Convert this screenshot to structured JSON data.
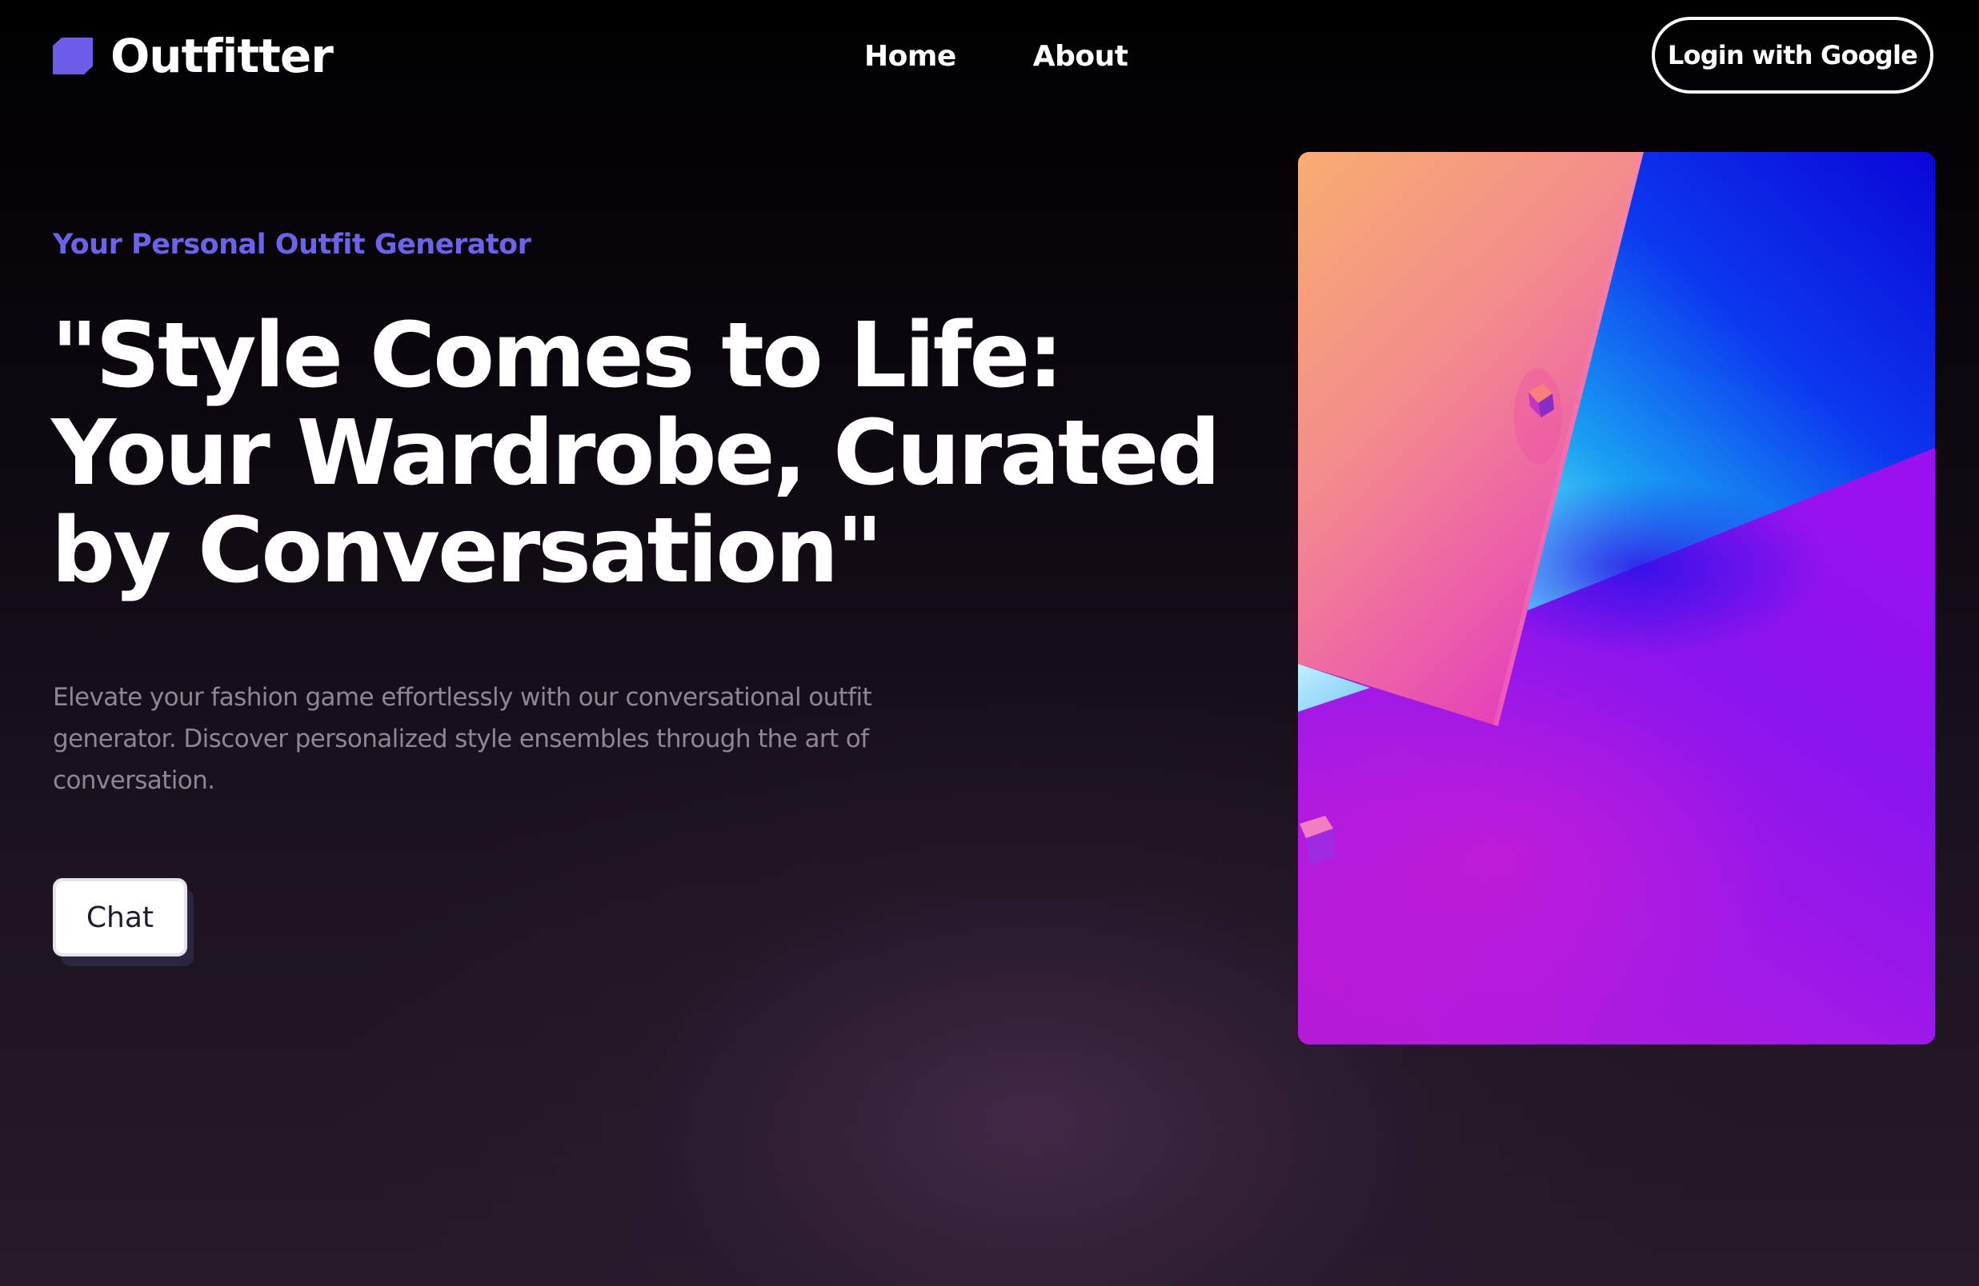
{
  "header": {
    "brand": "Outfitter",
    "logo_icon": "hexagon-logo-mark",
    "nav": [
      {
        "label": "Home"
      },
      {
        "label": "About"
      }
    ],
    "login_label": "Login with Google"
  },
  "hero": {
    "eyebrow": "Your Personal Outfit Generator",
    "title_lines": [
      "\"Style Comes to Life:",
      "Your Wardrobe, Curated",
      "by Conversation\""
    ],
    "description": "Elevate your fashion game effortlessly with our conversational outfit generator. Discover personalized style ensembles through the art of conversation.",
    "cta_label": "Chat"
  },
  "colors": {
    "accent": "#6c5ce7",
    "eyebrow": "#6c63e8",
    "background": "#0a0609",
    "description_text": "#8f8596"
  }
}
